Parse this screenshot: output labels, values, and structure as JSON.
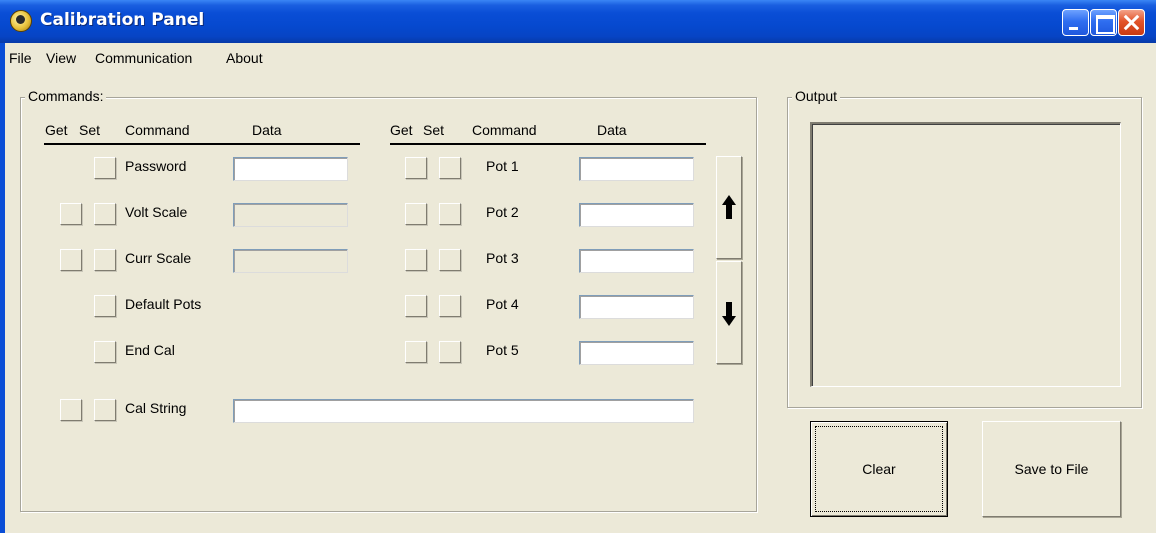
{
  "window": {
    "title": "Calibration Panel",
    "accent_color": "#0a4ed6",
    "background_color": "#ece9d8"
  },
  "menu": [
    "File",
    "View",
    "Communication",
    "About"
  ],
  "commands": {
    "group_label": "Commands:",
    "headers": {
      "get": "Get",
      "set": "Set",
      "command": "Command",
      "data": "Data"
    },
    "left_rows": [
      {
        "label": "Password",
        "has_get": false,
        "field": "enabled",
        "value": ""
      },
      {
        "label": "Volt Scale",
        "has_get": true,
        "field": "disabled",
        "value": ""
      },
      {
        "label": "Curr Scale",
        "has_get": true,
        "field": "disabled",
        "value": ""
      },
      {
        "label": "Default Pots",
        "has_get": false,
        "field": "none"
      },
      {
        "label": "End Cal",
        "has_get": false,
        "field": "none"
      }
    ],
    "right_rows": [
      {
        "label": "Pot 1",
        "value": ""
      },
      {
        "label": "Pot 2",
        "value": ""
      },
      {
        "label": "Pot 3",
        "value": ""
      },
      {
        "label": "Pot 4",
        "value": ""
      },
      {
        "label": "Pot 5",
        "value": ""
      }
    ],
    "cal_string": {
      "label": "Cal String",
      "value": ""
    },
    "scroll": {
      "up_icon": "arrow-up-icon",
      "down_icon": "arrow-down-icon"
    }
  },
  "output": {
    "group_label": "Output",
    "text": ""
  },
  "buttons": {
    "clear": "Clear",
    "save": "Save to File"
  }
}
